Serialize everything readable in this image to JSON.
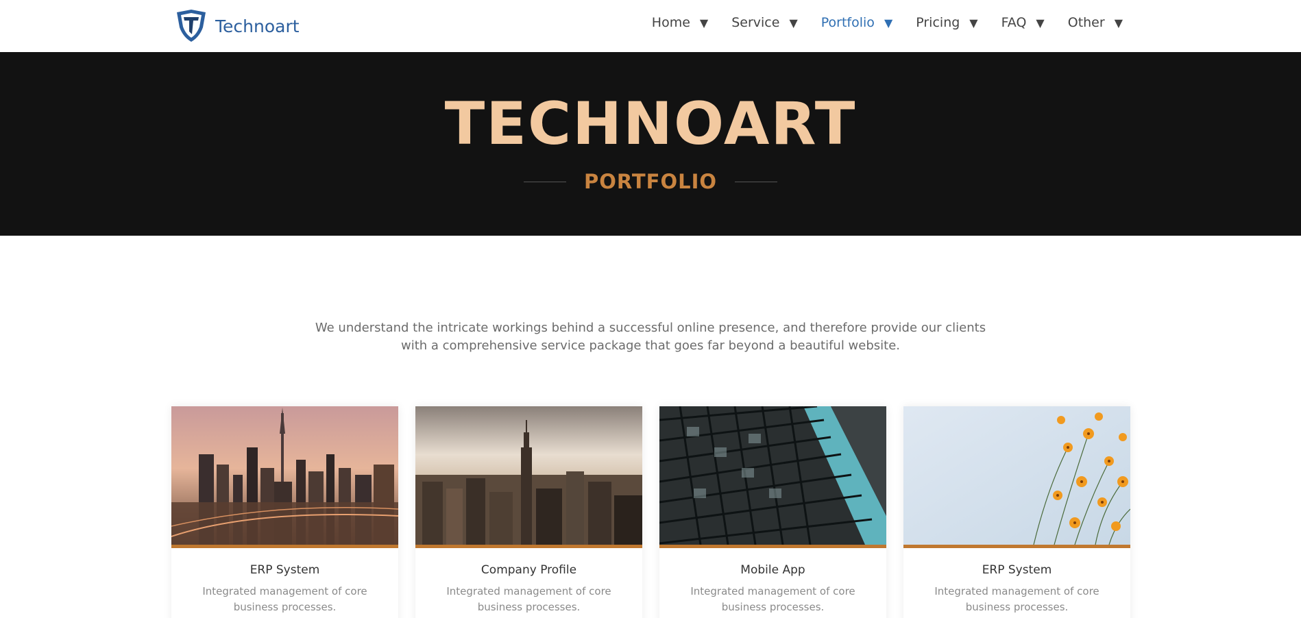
{
  "nav": {
    "brand": "Technoart",
    "items": [
      {
        "label": "Home",
        "active": false
      },
      {
        "label": "Service",
        "active": false
      },
      {
        "label": "Portfolio",
        "active": true
      },
      {
        "label": "Pricing",
        "active": false
      },
      {
        "label": "FAQ",
        "active": false
      },
      {
        "label": "Other",
        "active": false
      }
    ],
    "arrow_glyph": "▼"
  },
  "hero": {
    "title": "TECHNOART",
    "subtitle": "PORTFOLIO"
  },
  "intro": {
    "text": "We understand the intricate workings behind a successful online presence, and therefore provide our clients with a comprehensive service package that goes far beyond a beautiful website."
  },
  "cards": [
    {
      "title": "ERP System",
      "desc": "Integrated management of core business processes."
    },
    {
      "title": "Company Profile",
      "desc": "Integrated management of core business processes."
    },
    {
      "title": "Mobile App",
      "desc": "Integrated management of core business processes."
    },
    {
      "title": "ERP System",
      "desc": "Integrated management of core business processes."
    }
  ],
  "colors": {
    "brand_blue": "#2c5f9e",
    "active_link": "#2f6fb3",
    "hero_bg": "#121212",
    "hero_title": "#f2c9a0",
    "hero_subtitle": "#c98440",
    "card_accent": "#c0782f"
  }
}
